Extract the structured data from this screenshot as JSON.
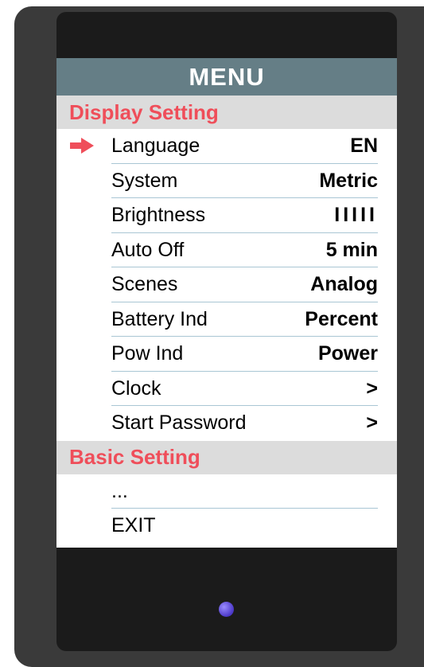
{
  "title": "MENU",
  "sections": [
    {
      "header": "Display Setting",
      "items": [
        {
          "label": "Language",
          "value": "EN"
        },
        {
          "label": "System",
          "value": "Metric"
        },
        {
          "label": "Brightness",
          "value": "IIIII"
        },
        {
          "label": "Auto Off",
          "value": "5 min"
        },
        {
          "label": "Scenes",
          "value": "Analog"
        },
        {
          "label": "Battery Ind",
          "value": "Percent"
        },
        {
          "label": "Pow Ind",
          "value": "Power"
        },
        {
          "label": "Clock",
          "value": ">"
        },
        {
          "label": "Start Password",
          "value": ">"
        }
      ]
    },
    {
      "header": "Basic Setting",
      "items": [
        {
          "label": "..."
        },
        {
          "label": "EXIT"
        }
      ]
    }
  ],
  "selected_item": "Language",
  "icons": {
    "selection": "arrow-right-icon",
    "indicator": "status-led"
  },
  "colors": {
    "title_bar": "#657e86",
    "section_text": "#ef4e5a",
    "section_bg": "#dcdcdc",
    "divider": "#a9c6d4",
    "led": "#5b45d6"
  }
}
